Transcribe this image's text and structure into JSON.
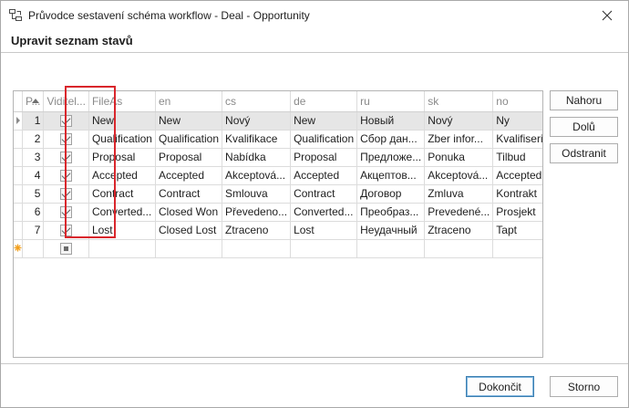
{
  "window": {
    "title": "Průvodce sestavení schéma workflow - Deal - Opportunity",
    "heading": "Upravit seznam stavů"
  },
  "grid": {
    "columns": [
      "P...",
      "Viditel...",
      "FileAs",
      "en",
      "cs",
      "de",
      "ru",
      "sk",
      "no"
    ],
    "rows": [
      {
        "pos": "1",
        "visible": true,
        "fileas": "New",
        "en": "New",
        "cs": "Nový",
        "de": "New",
        "ru": "Новый",
        "sk": "Nový",
        "no": "Ny"
      },
      {
        "pos": "2",
        "visible": true,
        "fileas": "Qualification",
        "en": "Qualification",
        "cs": "Kvalifikace",
        "de": "Qualification",
        "ru": "Сбор дан...",
        "sk": "Zber infor...",
        "no": "Kvalifisering"
      },
      {
        "pos": "3",
        "visible": true,
        "fileas": "Proposal",
        "en": "Proposal",
        "cs": "Nabídka",
        "de": "Proposal",
        "ru": "Предложе...",
        "sk": "Ponuka",
        "no": "Tilbud"
      },
      {
        "pos": "4",
        "visible": true,
        "fileas": "Accepted",
        "en": "Accepted",
        "cs": "Akceptová...",
        "de": "Accepted",
        "ru": "Акцептов...",
        "sk": "Akceptová...",
        "no": "Accepted"
      },
      {
        "pos": "5",
        "visible": true,
        "fileas": "Contract",
        "en": "Contract",
        "cs": "Smlouva",
        "de": "Contract",
        "ru": "Договор",
        "sk": "Zmluva",
        "no": "Kontrakt"
      },
      {
        "pos": "6",
        "visible": true,
        "fileas": "Converted...",
        "en": "Closed Won",
        "cs": "Převedeno...",
        "de": "Converted...",
        "ru": "Преобраз...",
        "sk": "Prevedené...",
        "no": "Prosjekt"
      },
      {
        "pos": "7",
        "visible": true,
        "fileas": "Lost",
        "en": "Closed Lost",
        "cs": "Ztraceno",
        "de": "Lost",
        "ru": "Неудачный",
        "sk": "Ztraceno",
        "no": "Tapt"
      }
    ],
    "new_row_icon": "asterisk-icon",
    "current_row_icon": "row-pointer-icon"
  },
  "side_buttons": {
    "up": "Nahoru",
    "down": "Dolů",
    "remove": "Odstranit"
  },
  "footer": {
    "finish": "Dokončit",
    "cancel": "Storno"
  },
  "colors": {
    "highlight": "#d9262c",
    "selected_row": "#e6e6e6",
    "primary_border": "#3c7fb1",
    "new_row_star": "#f2a01e"
  }
}
